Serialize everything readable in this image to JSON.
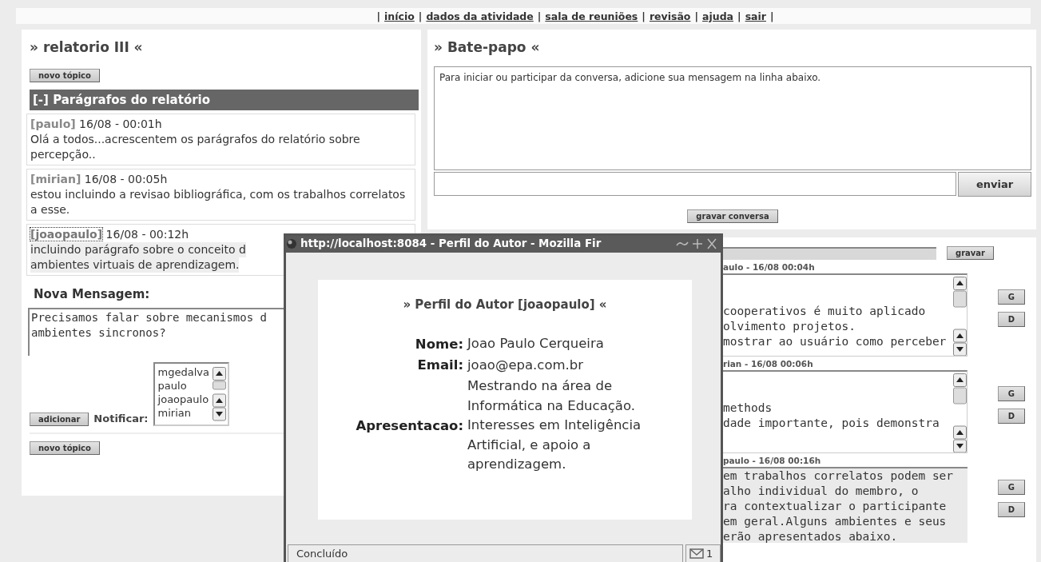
{
  "nav": {
    "separator": "|",
    "links": [
      "início",
      "dados da atividade",
      "sala de reuniões",
      "revisão",
      "ajuda",
      "sair"
    ]
  },
  "report": {
    "title": "» relatorio III «",
    "new_topic": "novo tópico",
    "section": "[-] Parágrafos do relatório",
    "entries": [
      {
        "author": "[paulo]",
        "time": "16/08 - 00:01h",
        "text": "Olá a todos...acrescentem os parágrafos do relatório sobre percepção..",
        "selected": false
      },
      {
        "author": "[mirian]",
        "time": "16/08 - 00:05h",
        "text": "estou incluindo a revisao bibliográfica, com os trabalhos correlatos a esse.",
        "selected": false
      },
      {
        "author": "[joaopaulo]",
        "time": "16/08 - 00:12h",
        "lines": [
          "incluindo parágrafo sobre o conceito d",
          "ambientes virtuais de aprendizagem."
        ],
        "selected": true
      }
    ],
    "new_message_label": "Nova Mensagem:",
    "message_lines": [
      "Precisamos falar sobre mecanismos d",
      "ambientes sincronos?"
    ],
    "add_button": "adicionar",
    "notify_label": "Notificar:",
    "notify_list": [
      "mgedalva",
      "paulo",
      "joaopaulo",
      "mirian"
    ],
    "new_topic_bottom": "novo tópico"
  },
  "chat": {
    "title": "» Bate-papo «",
    "log": "Para iniciar ou participar da conversa, adicione sua mensagem na linha abaixo.",
    "send_button": "enviar",
    "save_button": "gravar conversa"
  },
  "review": {
    "save_button": "gravar",
    "blocks": [
      {
        "header": "aulo - 16/08 00:04h",
        "lines": [
          "cooperativos é muito aplicado",
          "olvimento projetos.",
          "mostrar ao usuário como perceber"
        ],
        "scrollbar": true,
        "buttons": [
          "G",
          "D"
        ]
      },
      {
        "header": "rian - 16/08 00:06h",
        "lines": [
          "methods",
          "dade importante, pois demonstra"
        ],
        "scrollbar": true,
        "buttons": [
          "G",
          "D"
        ]
      },
      {
        "header": "paulo - 16/08 00:16h",
        "lines": [
          "em trabalhos correlatos podem ser",
          "alho individual do membro, o",
          "ra contextualizar o participante",
          "em geral.Alguns ambientes e seus",
          "erão apresentados abaixo."
        ],
        "scrollbar": false,
        "buttons": [
          "G",
          "D"
        ]
      }
    ]
  },
  "popup": {
    "title": "http://localhost:8084 - Perfil do Autor - Mozilla Fir",
    "heading": "» Perfil do Autor [joaopaulo] «",
    "fields": [
      {
        "label": "Nome:",
        "value": "Joao Paulo Cerqueira"
      },
      {
        "label": "Email:",
        "value": "joao@epa.com.br"
      },
      {
        "label": "Apresentacao:",
        "value": "Mestrando na área de Informática na Educação. Interesses em Inteligência Artificial, e apoio a aprendizagem."
      }
    ],
    "status": "Concluído",
    "mail_count": "1"
  }
}
